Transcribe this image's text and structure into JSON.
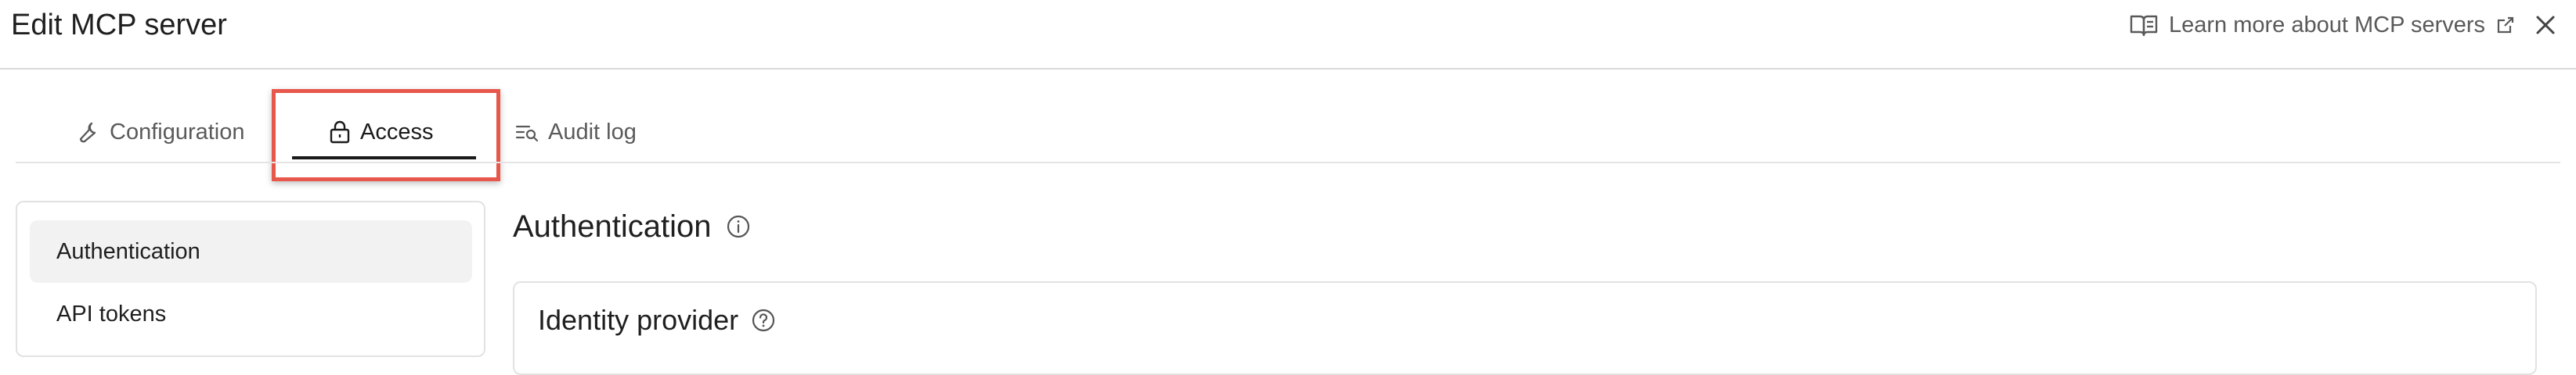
{
  "header": {
    "title": "Edit MCP server",
    "learn_more_label": "Learn more about MCP servers",
    "learn_more_icon": "book-open-icon",
    "external_icon": "external-link-icon",
    "close_icon": "close-icon"
  },
  "tabs": [
    {
      "label": "Configuration",
      "icon": "wrench-icon",
      "active": false
    },
    {
      "label": "Access",
      "icon": "lock-icon",
      "active": true
    },
    {
      "label": "Audit log",
      "icon": "search-list-icon",
      "active": false
    }
  ],
  "sidebar": {
    "items": [
      {
        "label": "Authentication",
        "selected": true
      },
      {
        "label": "API tokens",
        "selected": false
      }
    ]
  },
  "main": {
    "section_title": "Authentication",
    "section_info_icon": "info-icon",
    "panel_title": "Identity provider",
    "panel_help_icon": "help-circle-icon"
  },
  "colors": {
    "highlight": "#e8574b",
    "text": "#1f1f1f",
    "muted": "#5a5a5a",
    "selected_bg": "#f2f2f2"
  }
}
